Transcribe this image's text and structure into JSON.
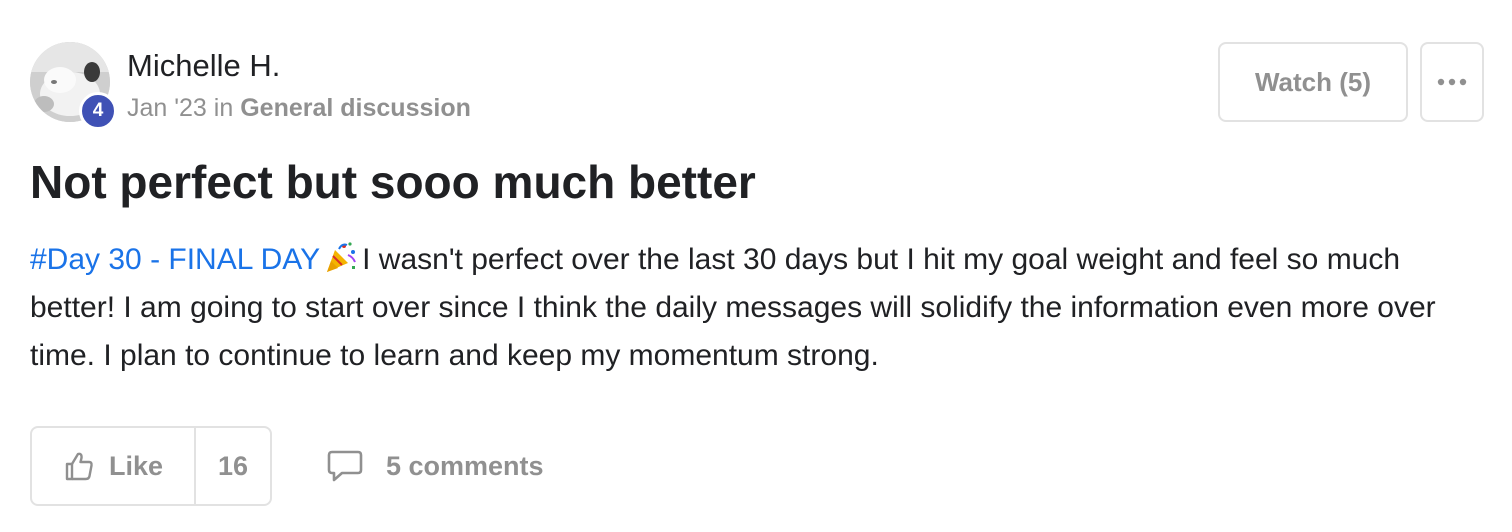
{
  "post": {
    "author": {
      "name": "Michelle H.",
      "level": "4",
      "avatar_icon": "avatar-photo"
    },
    "meta": {
      "date": "Jan '23",
      "in_label": "in",
      "category": "General discussion"
    },
    "actions": {
      "watch_label": "Watch (5)",
      "more_icon": "ellipsis-icon"
    },
    "title": "Not perfect but sooo much better",
    "body": {
      "hashtag": "#Day 30 - FINAL DAY",
      "emoji_icon": "party-popper-icon",
      "text": "I wasn't perfect over the last 30 days but I hit my goal weight and feel so much better! I am going to start over since I think the daily messages will solidify the information even more over time. I plan to continue to learn and keep my momentum strong."
    },
    "footer": {
      "like_label": "Like",
      "like_count": "16",
      "comments_label": "5 comments"
    },
    "colors": {
      "accent_link": "#1a73e8",
      "level_badge": "#3f51b5",
      "muted_text": "#909090",
      "border": "#e2e2e2"
    }
  }
}
